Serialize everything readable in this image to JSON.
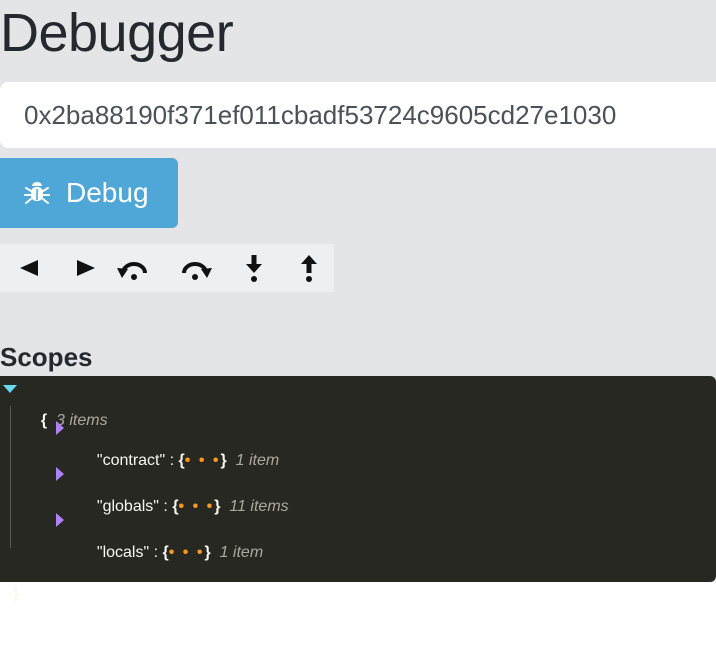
{
  "page": {
    "title": "Debugger"
  },
  "tx_input": {
    "value": "0x2ba88190f371ef011cbadf53724c9605cd27e1030"
  },
  "debug_button": {
    "label": "Debug",
    "icon": "bug-icon"
  },
  "toolbar": {
    "buttons": [
      {
        "name": "step-back",
        "icon": "triangle-left-icon"
      },
      {
        "name": "step-forward",
        "icon": "triangle-right-icon"
      },
      {
        "name": "step-over-back",
        "icon": "curved-arrow-back-icon"
      },
      {
        "name": "step-over",
        "icon": "curved-arrow-forward-icon"
      },
      {
        "name": "step-into",
        "icon": "arrow-down-icon"
      },
      {
        "name": "step-out",
        "icon": "arrow-up-icon"
      }
    ]
  },
  "scopes": {
    "label": "Scopes",
    "root": {
      "open": "{",
      "close": "}",
      "count": "3 items"
    },
    "entries": [
      {
        "key": "\"contract\"",
        "colon": ":",
        "preview": "{",
        "dots": "• • •",
        "end": "}",
        "count": "1 item"
      },
      {
        "key": "\"globals\"",
        "colon": ":",
        "preview": "{",
        "dots": "• • •",
        "end": "}",
        "count": "11 items"
      },
      {
        "key": "\"locals\"",
        "colon": ":",
        "preview": "{",
        "dots": "• • •",
        "end": "}",
        "count": "1 item"
      }
    ]
  },
  "colors": {
    "panel_bg": "#e4e5e7",
    "debug_button_bg": "#4fa7d8",
    "json_bg": "#272822",
    "ellipsis": "#fd971f",
    "caret_root": "#66d9ef",
    "caret_child": "#ae81ff"
  }
}
